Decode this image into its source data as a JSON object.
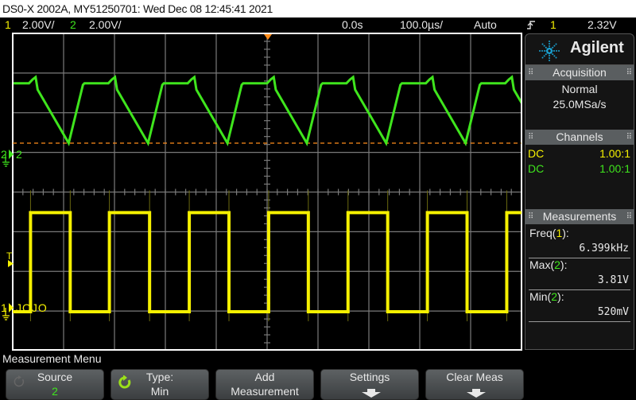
{
  "title_bar": "DS0-X 2002A, MY51250701: Wed Dec 08 12:45:41 2021",
  "status": {
    "ch1_num": "1",
    "ch1_scale": "2.00V/",
    "ch2_num": "2",
    "ch2_scale": "2.00V/",
    "time_delay": "0.0s",
    "time_scale": "100.0µs/",
    "trigger_mode": "Auto",
    "trigger_slope_icon": "rising-edge-icon",
    "trigger_source": "1",
    "trigger_level": "2.32V"
  },
  "colors": {
    "ch1": "#f5f000",
    "ch2": "#3fe51d",
    "trigger": "#ff8c1a",
    "grid": "#7a7a7a",
    "brand_star": "#1aa0d0"
  },
  "screen": {
    "ch2_marker": "2",
    "ch2_label": "2",
    "ch1_marker": "1",
    "ch1_label": "JOJO",
    "trigger_marker": "T"
  },
  "waveforms": {
    "ch1": {
      "type": "square",
      "high_v": 5.0,
      "low_v": 0.0,
      "frequency": "6.399kHz",
      "rising_edges_us": [
        -465,
        -310,
        -153,
        3,
        159,
        315,
        471
      ],
      "falling_edges_us": [
        -387,
        -231,
        -75,
        81,
        237,
        393
      ]
    },
    "ch2": {
      "type": "sawtooth-like",
      "plateau_v": 3.5,
      "peak_v": 3.81,
      "min_v": 0.52,
      "valleys_us": [
        -390,
        -234,
        -78,
        78,
        234,
        390
      ]
    }
  },
  "side_panel": {
    "brand": "Agilent",
    "acquisition": {
      "header": "Acquisition",
      "mode": "Normal",
      "rate": "25.0MSa/s"
    },
    "channels": {
      "header": "Channels",
      "rows": [
        {
          "coupling": "DC",
          "probe": "1.00:1"
        },
        {
          "coupling": "DC",
          "probe": "1.00:1"
        }
      ]
    },
    "measurements": {
      "header": "Measurements",
      "items": [
        {
          "name": "Freq(",
          "src": "1",
          "suffix": "):",
          "value": "6.399kHz"
        },
        {
          "name": "Max(",
          "src": "2",
          "suffix": "):",
          "value": "3.81V"
        },
        {
          "name": "Min(",
          "src": "2",
          "suffix": "):",
          "value": "520mV"
        }
      ]
    }
  },
  "menu": {
    "title": "Measurement Menu",
    "softkeys": [
      {
        "line1": "Source",
        "line2": "2"
      },
      {
        "line1": "Type:",
        "line2": "Min"
      },
      {
        "line1": "Add",
        "line2": "Measurement"
      },
      {
        "line1": "Settings",
        "line2": ""
      },
      {
        "line1": "Clear Meas",
        "line2": ""
      }
    ]
  }
}
